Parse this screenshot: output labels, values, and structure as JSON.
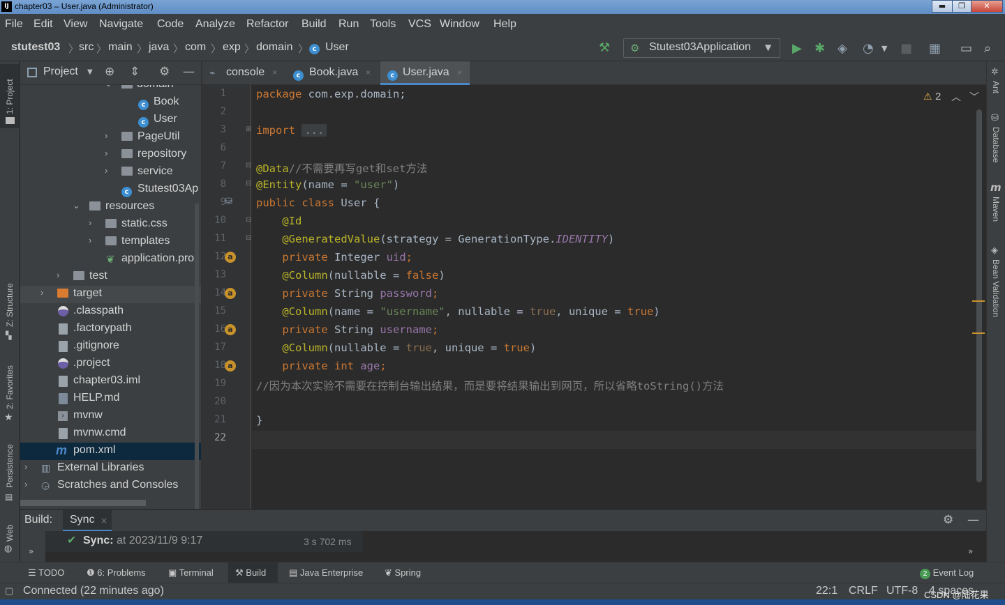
{
  "window": {
    "title": "chapter03 – User.java (Administrator)",
    "logo": "IJ",
    "min": "▬",
    "max": "❐",
    "close": "✕"
  },
  "menu": [
    "File",
    "Edit",
    "View",
    "Navigate",
    "Code",
    "Analyze",
    "Refactor",
    "Build",
    "Run",
    "Tools",
    "VCS",
    "Window",
    "Help"
  ],
  "breadcrumb": [
    "stutest03",
    "src",
    "main",
    "java",
    "com",
    "exp",
    "domain",
    "User"
  ],
  "run_config": "Stutest03Application",
  "left_stripe": [
    "1: Project",
    "Z: Structure",
    "2: Favorites",
    "Persistence",
    "Web"
  ],
  "right_stripe": [
    "Ant",
    "Database",
    "Maven",
    "Bean Validation"
  ],
  "project_panel": {
    "title": "Project"
  },
  "tree": [
    {
      "label": "domain",
      "icon": "folder-icon",
      "arrow": "⌄"
    },
    {
      "label": "Book",
      "icon": "class-icon",
      "arrow": ""
    },
    {
      "label": "User",
      "icon": "class-icon",
      "arrow": ""
    },
    {
      "label": "PageUtil",
      "icon": "package-icon",
      "arrow": "›"
    },
    {
      "label": "repository",
      "icon": "package-icon",
      "arrow": "›"
    },
    {
      "label": "service",
      "icon": "package-icon",
      "arrow": "›"
    },
    {
      "label": "Stutest03Ap",
      "icon": "spring-class-icon",
      "arrow": ""
    },
    {
      "label": "resources",
      "icon": "resources-folder-icon",
      "arrow": "⌄"
    },
    {
      "label": "static.css",
      "icon": "folder-icon",
      "arrow": "›"
    },
    {
      "label": "templates",
      "icon": "folder-icon",
      "arrow": "›"
    },
    {
      "label": "application.pro",
      "icon": "spring-properties-icon",
      "arrow": ""
    },
    {
      "label": "test",
      "icon": "folder-icon",
      "arrow": "›"
    },
    {
      "label": "target",
      "icon": "excluded-folder-icon",
      "arrow": "›"
    },
    {
      "label": ".classpath",
      "icon": "eclipse-file-icon",
      "arrow": ""
    },
    {
      "label": ".factorypath",
      "icon": "file-icon",
      "arrow": ""
    },
    {
      "label": ".gitignore",
      "icon": "file-icon",
      "arrow": ""
    },
    {
      "label": ".project",
      "icon": "eclipse-file-icon",
      "arrow": ""
    },
    {
      "label": "chapter03.iml",
      "icon": "file-icon",
      "arrow": ""
    },
    {
      "label": "HELP.md",
      "icon": "markdown-icon",
      "arrow": ""
    },
    {
      "label": "mvnw",
      "icon": "shell-file-icon",
      "arrow": ""
    },
    {
      "label": "mvnw.cmd",
      "icon": "file-icon",
      "arrow": ""
    },
    {
      "label": "pom.xml",
      "icon": "maven-icon",
      "arrow": ""
    },
    {
      "label": "External Libraries",
      "icon": "libraries-icon",
      "arrow": "›"
    },
    {
      "label": "Scratches and Consoles",
      "icon": "scratches-icon",
      "arrow": "›"
    }
  ],
  "tabs": [
    {
      "label": "console",
      "close": "×"
    },
    {
      "label": "Book.java",
      "close": "×"
    },
    {
      "label": "User.java",
      "close": "×"
    }
  ],
  "editor": {
    "warnings": "2",
    "line_numbers": [
      "1",
      "2",
      "3",
      "6",
      "7",
      "8",
      "9",
      "10",
      "11",
      "12",
      "13",
      "14",
      "15",
      "16",
      "17",
      "18",
      "19",
      "20",
      "21",
      "22"
    ],
    "lines": {
      "l1_kw": "package",
      "l1_rest": " com.exp.domain;",
      "l3_kw": "import",
      "l3_fold": "...",
      "l7_an": "@Data",
      "l7_cm": "//不需要再写get和set方法",
      "l8_an": "@Entity",
      "l8_a": "(name = ",
      "l8_s": "\"user\"",
      "l8_b": ")",
      "l9_kw": "public class",
      "l9_rest": " User {",
      "l10_an": "@Id",
      "l11_an": "@GeneratedValue",
      "l11_a": "(strategy = GenerationType.",
      "l11_it": "IDENTITY",
      "l11_b": ")",
      "l12_kw": "private",
      "l12_t": " Integer ",
      "l12_f": "uid",
      "l12_e": ";",
      "l13_an": "@Column",
      "l13_a": "(nullable = ",
      "l13_kw": "false",
      "l13_b": ")",
      "l14_kw": "private",
      "l14_t": " String ",
      "l14_f": "password",
      "l14_e": ";",
      "l15_an": "@Column",
      "l15_a": "(name = ",
      "l15_s": "\"username\"",
      "l15_c": ", nullable = ",
      "l15_kw1": "true",
      "l15_d": ", unique = ",
      "l15_kw2": "true",
      "l15_b": ")",
      "l16_kw": "private",
      "l16_t": " String ",
      "l16_f": "username",
      "l16_e": ";",
      "l17_an": "@Column",
      "l17_a": "(nullable = ",
      "l17_kw1": "true",
      "l17_d": ", unique = ",
      "l17_kw2": "true",
      "l17_b": ")",
      "l18_kw": "private int",
      "l18_t": " ",
      "l18_f": "age",
      "l18_e": ";",
      "l19_cm": "//因为本次实验不需要在控制台输出结果，而是要将结果输出到网页，所以省略toString()方法",
      "l21": "}"
    }
  },
  "build": {
    "label": "Build:",
    "tab": "Sync",
    "tab_close": "×",
    "sync_title": "Sync:",
    "sync_time": "at 2023/11/9 9:17",
    "duration": "3 s 702 ms"
  },
  "toolwindows": [
    "TODO",
    "6: Problems",
    "Terminal",
    "Build",
    "Java Enterprise",
    "Spring"
  ],
  "event_log": "Event Log",
  "event_count": "2",
  "status": {
    "message": "Connected (22 minutes ago)",
    "position": "22:1",
    "line_sep": "CRLF",
    "encoding": "UTF-8",
    "indent": "4 spaces",
    "watermark": "CSDN @陆花果"
  },
  "colors": {
    "keyword": "#cc7832",
    "annotation": "#bbb529",
    "string": "#6a8759",
    "field": "#9876aa",
    "comment": "#808080",
    "selection": "#0d293e"
  }
}
